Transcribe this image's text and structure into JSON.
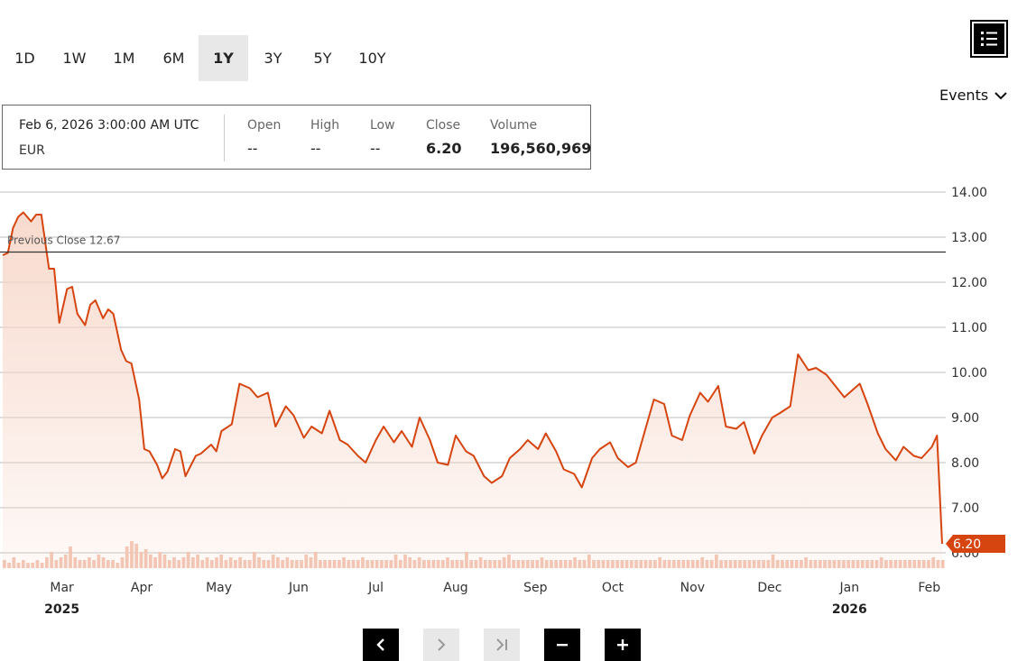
{
  "ranges": [
    "1D",
    "1W",
    "1M",
    "6M",
    "1Y",
    "3Y",
    "5Y",
    "10Y"
  ],
  "active_range": "1Y",
  "events_label": "Events",
  "info": {
    "date": "Feb 6, 2026 3:00:00 AM UTC",
    "currency": "EUR",
    "open_label": "Open",
    "open_value": "--",
    "high_label": "High",
    "high_value": "--",
    "low_label": "Low",
    "low_value": "--",
    "close_label": "Close",
    "close_value": "6.20",
    "volume_label": "Volume",
    "volume_value": "196,560,969"
  },
  "icons": {
    "menu": "list-icon",
    "events": "chevron-down-icon",
    "prev": "chevron-left-icon",
    "next": "chevron-right-icon",
    "latest": "skip-to-latest-icon",
    "zoom_out": "minus-icon",
    "zoom_in": "plus-icon"
  },
  "colors": {
    "line": "#d64510",
    "area": "#f7d6c8",
    "volume": "#f2c2b0",
    "badge": "#d64510"
  },
  "chart_data": {
    "type": "area",
    "y_ticks": [
      "14.00",
      "13.00",
      "12.00",
      "11.00",
      "10.00",
      "9.00",
      "8.00",
      "7.00",
      "6.00"
    ],
    "ylim": [
      5.7,
      14.3
    ],
    "x_ticks": [
      "Mar",
      "Apr",
      "May",
      "Jun",
      "Jul",
      "Aug",
      "Sep",
      "Oct",
      "Nov",
      "Dec",
      "Jan",
      "Feb"
    ],
    "year_labels": [
      "2025",
      "2026"
    ],
    "previous_close_label": "Previous Close 12.67",
    "previous_close": 12.67,
    "last_value_label": "6.20",
    "last_value": 6.2,
    "series": [
      {
        "x": [
          "2025-02-06",
          "2025-02-08",
          "2025-02-10",
          "2025-02-12",
          "2025-02-14",
          "2025-02-17",
          "2025-02-19",
          "2025-02-21",
          "2025-02-24",
          "2025-02-26",
          "2025-02-28",
          "2025-03-03",
          "2025-03-05",
          "2025-03-07",
          "2025-03-10",
          "2025-03-12",
          "2025-03-14",
          "2025-03-17",
          "2025-03-19",
          "2025-03-21",
          "2025-03-24",
          "2025-03-26",
          "2025-03-28",
          "2025-03-31",
          "2025-04-02",
          "2025-04-04",
          "2025-04-07",
          "2025-04-09",
          "2025-04-11",
          "2025-04-14",
          "2025-04-16",
          "2025-04-18",
          "2025-04-22",
          "2025-04-24",
          "2025-04-28",
          "2025-04-30",
          "2025-05-02",
          "2025-05-06",
          "2025-05-09",
          "2025-05-13",
          "2025-05-16",
          "2025-05-20",
          "2025-05-23",
          "2025-05-27",
          "2025-05-30",
          "2025-06-03",
          "2025-06-06",
          "2025-06-10",
          "2025-06-13",
          "2025-06-17",
          "2025-06-20",
          "2025-06-24",
          "2025-06-27",
          "2025-07-01",
          "2025-07-04",
          "2025-07-08",
          "2025-07-11",
          "2025-07-15",
          "2025-07-18",
          "2025-07-22",
          "2025-07-25",
          "2025-07-29",
          "2025-08-01",
          "2025-08-05",
          "2025-08-08",
          "2025-08-12",
          "2025-08-15",
          "2025-08-19",
          "2025-08-22",
          "2025-08-26",
          "2025-08-29",
          "2025-09-02",
          "2025-09-05",
          "2025-09-09",
          "2025-09-12",
          "2025-09-16",
          "2025-09-19",
          "2025-09-23",
          "2025-09-26",
          "2025-09-30",
          "2025-10-03",
          "2025-10-07",
          "2025-10-10",
          "2025-10-14",
          "2025-10-17",
          "2025-10-21",
          "2025-10-24",
          "2025-10-28",
          "2025-10-31",
          "2025-11-04",
          "2025-11-07",
          "2025-11-11",
          "2025-11-14",
          "2025-11-18",
          "2025-11-21",
          "2025-11-25",
          "2025-11-28",
          "2025-12-02",
          "2025-12-05",
          "2025-12-09",
          "2025-12-12",
          "2025-12-16",
          "2025-12-19",
          "2025-12-23",
          "2025-12-30",
          "2026-01-05",
          "2026-01-08",
          "2026-01-12",
          "2026-01-15",
          "2026-01-19",
          "2026-01-22",
          "2026-01-26",
          "2026-01-29",
          "2026-02-02",
          "2026-02-04",
          "2026-02-06"
        ],
        "values": [
          12.6,
          12.65,
          13.2,
          13.45,
          13.55,
          13.35,
          13.5,
          13.5,
          12.3,
          12.3,
          11.1,
          11.85,
          11.9,
          11.3,
          11.05,
          11.5,
          11.6,
          11.2,
          11.4,
          11.3,
          10.5,
          10.25,
          10.2,
          9.4,
          8.3,
          8.25,
          7.95,
          7.65,
          7.8,
          8.3,
          8.25,
          7.7,
          8.15,
          8.2,
          8.4,
          8.25,
          8.7,
          8.85,
          9.75,
          9.65,
          9.45,
          9.55,
          8.8,
          9.25,
          9.05,
          8.55,
          8.8,
          8.65,
          9.15,
          8.5,
          8.4,
          8.15,
          8.0,
          8.5,
          8.8,
          8.45,
          8.7,
          8.35,
          9.0,
          8.5,
          8.0,
          7.95,
          8.6,
          8.25,
          8.15,
          7.7,
          7.55,
          7.7,
          8.1,
          8.3,
          8.5,
          8.3,
          8.65,
          8.25,
          7.85,
          7.75,
          7.45,
          8.1,
          8.3,
          8.45,
          8.1,
          7.9,
          8.0,
          8.8,
          9.4,
          9.3,
          8.6,
          8.5,
          9.05,
          9.55,
          9.35,
          9.7,
          8.8,
          8.75,
          8.9,
          8.2,
          8.6,
          9.0,
          9.1,
          9.25,
          10.4,
          10.05,
          10.1,
          9.95,
          9.45,
          9.75,
          9.3,
          8.65,
          8.3,
          8.05,
          8.35,
          8.15,
          8.1,
          8.35,
          8.6,
          6.2
        ]
      }
    ]
  },
  "volume_data": [
    3,
    2,
    4,
    2,
    3,
    2,
    2,
    3,
    2,
    4,
    6,
    3,
    4,
    5,
    8,
    4,
    3,
    3,
    4,
    3,
    5,
    4,
    3,
    3,
    2,
    4,
    8,
    10,
    9,
    6,
    7,
    5,
    4,
    6,
    5,
    3,
    4,
    3,
    4,
    6,
    4,
    5,
    3,
    4,
    3,
    4,
    5,
    3,
    4,
    3,
    4,
    3,
    3,
    6,
    4,
    3,
    3,
    5,
    4,
    3,
    4,
    3,
    3,
    3,
    5,
    4,
    6,
    3,
    3,
    3,
    3,
    3,
    4,
    3,
    3,
    3,
    4,
    3,
    3,
    3,
    3,
    3,
    3,
    5,
    3,
    5,
    4,
    3,
    4,
    3,
    3,
    3,
    3,
    3,
    4,
    3,
    3,
    3,
    6,
    3,
    3,
    4,
    3,
    3,
    3,
    3,
    4,
    5,
    3,
    3,
    3,
    3,
    3,
    3,
    4,
    3,
    3,
    3,
    3,
    3,
    3,
    4,
    3,
    3,
    5,
    3,
    3,
    3,
    3,
    3,
    3,
    3,
    3,
    3,
    3,
    3,
    3,
    3,
    3,
    4,
    3,
    3,
    3,
    3,
    3,
    3,
    3,
    3,
    4,
    3,
    3,
    5,
    3,
    3,
    3,
    3,
    3,
    3,
    3,
    3,
    3,
    3,
    3,
    5,
    3,
    3,
    3,
    3,
    3,
    3,
    4,
    3,
    3,
    3,
    3,
    3,
    3,
    3,
    3,
    3,
    3,
    3,
    3,
    3,
    3,
    3,
    4,
    3,
    3,
    3,
    3,
    3,
    3,
    3,
    3,
    3,
    3,
    4,
    3,
    3
  ]
}
